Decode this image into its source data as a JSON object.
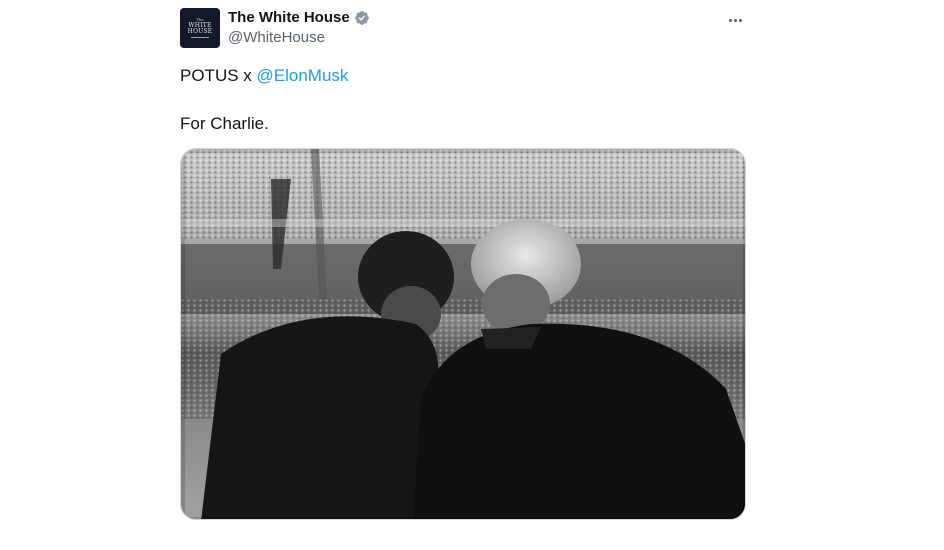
{
  "account": {
    "display_name": "The White House",
    "handle": "@WhiteHouse",
    "avatar_text": [
      "The",
      "WHITE",
      "HOUSE"
    ],
    "verified_icon": "verified-badge-icon",
    "verified_color": "#8b98a5"
  },
  "tweet": {
    "line1_prefix": "POTUS x ",
    "mention": "@ElonMusk",
    "line2": "For Charlie."
  },
  "menu": {
    "icon": "more-options-icon"
  },
  "media": {
    "type": "photo",
    "tone": "black-and-white"
  },
  "colors": {
    "link": "#1d9bf0",
    "secondary_text": "#536471",
    "border": "#cfd9de"
  }
}
